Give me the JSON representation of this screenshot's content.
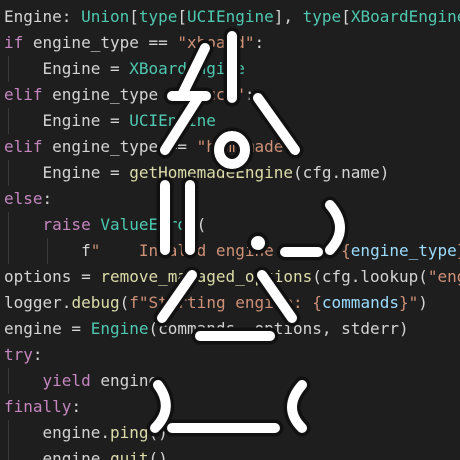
{
  "editor": {
    "background": "#1e1e1e",
    "colors": {
      "default": "#d4d4d4",
      "keyword": "#c586c0",
      "type": "#4ec9b0",
      "string": "#ce9178",
      "function": "#dcdcaa",
      "parameter": "#9cdcfe"
    },
    "lines": [
      {
        "tokens": [
          [
            "Engine: ",
            "tk"
          ],
          [
            "Union",
            "ty"
          ],
          [
            "[",
            "tk"
          ],
          [
            "type",
            "ty"
          ],
          [
            "[",
            "tk"
          ],
          [
            "UCIEngine",
            "ty"
          ],
          [
            "], ",
            "tk"
          ],
          [
            "type",
            "ty"
          ],
          [
            "[",
            "tk"
          ],
          [
            "XBoardEngine",
            "ty"
          ],
          [
            "]]",
            "tk"
          ]
        ]
      },
      {
        "tokens": [
          [
            "if",
            "kw"
          ],
          [
            " engine_type == ",
            "tk"
          ],
          [
            "\"xboard\"",
            "st"
          ],
          [
            ":",
            "tk"
          ]
        ]
      },
      {
        "indent": 1,
        "tokens": [
          [
            "    Engine = ",
            "tk"
          ],
          [
            "XBoardEngine",
            "ty"
          ]
        ]
      },
      {
        "tokens": [
          [
            "elif",
            "kw"
          ],
          [
            " engine_type == ",
            "tk"
          ],
          [
            "\"uci\"",
            "st"
          ],
          [
            ":",
            "tk"
          ]
        ]
      },
      {
        "indent": 1,
        "tokens": [
          [
            "    Engine = ",
            "tk"
          ],
          [
            "UCIEngine",
            "ty"
          ]
        ]
      },
      {
        "tokens": [
          [
            "elif",
            "kw"
          ],
          [
            " engine_type == ",
            "tk"
          ],
          [
            "\"homemade\"",
            "st"
          ],
          [
            ":",
            "tk"
          ]
        ]
      },
      {
        "indent": 1,
        "tokens": [
          [
            "    Engine = ",
            "tk"
          ],
          [
            "getHomemadeEngine",
            "fn"
          ],
          [
            "(cfg.name)",
            "tk"
          ]
        ]
      },
      {
        "tokens": [
          [
            "else",
            "kw"
          ],
          [
            ":",
            "tk"
          ]
        ]
      },
      {
        "indent": 1,
        "tokens": [
          [
            "    ",
            "tk"
          ],
          [
            "raise",
            "kw"
          ],
          [
            " ",
            "tk"
          ],
          [
            "ValueError",
            "ty"
          ],
          [
            "(",
            "tk"
          ]
        ]
      },
      {
        "indent": 2,
        "tokens": [
          [
            "        f",
            "tk"
          ],
          [
            "\"    Invalid engine type: {",
            "st"
          ],
          [
            "engine_type",
            "pm"
          ],
          [
            "}\"",
            "st"
          ]
        ]
      },
      {
        "tokens": [
          [
            "options = ",
            "tk"
          ],
          [
            "remove_managed_options",
            "fn"
          ],
          [
            "(cfg.lookup(",
            "tk"
          ],
          [
            "\"engine_options\"",
            "st"
          ],
          [
            "))",
            "tk"
          ]
        ]
      },
      {
        "tokens": [
          [
            "logger.",
            "tk"
          ],
          [
            "debug",
            "fn"
          ],
          [
            "(",
            "tk"
          ],
          [
            "f\"Starting engine: {",
            "st"
          ],
          [
            "commands",
            "pm"
          ],
          [
            "}\"",
            "st"
          ],
          [
            ")",
            "tk"
          ]
        ]
      },
      {
        "tokens": [
          [
            "engine = ",
            "tk"
          ],
          [
            "Engine",
            "ty"
          ],
          [
            "(commands, options, stderr)",
            "tk"
          ]
        ]
      },
      {
        "tokens": [
          [
            "try",
            "kw"
          ],
          [
            ":",
            "tk"
          ]
        ]
      },
      {
        "indent": 1,
        "tokens": [
          [
            "    ",
            "tk"
          ],
          [
            "yield",
            "kw"
          ],
          [
            " engine",
            "tk"
          ]
        ]
      },
      {
        "tokens": [
          [
            "finally",
            "kw"
          ],
          [
            ":",
            "tk"
          ]
        ]
      },
      {
        "indent": 1,
        "tokens": [
          [
            "    engine.",
            "tk"
          ],
          [
            "ping",
            "fn"
          ],
          [
            "()",
            "tk"
          ]
        ]
      },
      {
        "indent": 1,
        "tokens": [
          [
            "    engine.",
            "tk"
          ],
          [
            "quit",
            "fn"
          ],
          [
            "()",
            "tk"
          ]
        ]
      }
    ]
  },
  "overlay": {
    "name": "ascii-art-robot",
    "stroke_color": "#ffffff",
    "shadow_color": "#111111"
  }
}
